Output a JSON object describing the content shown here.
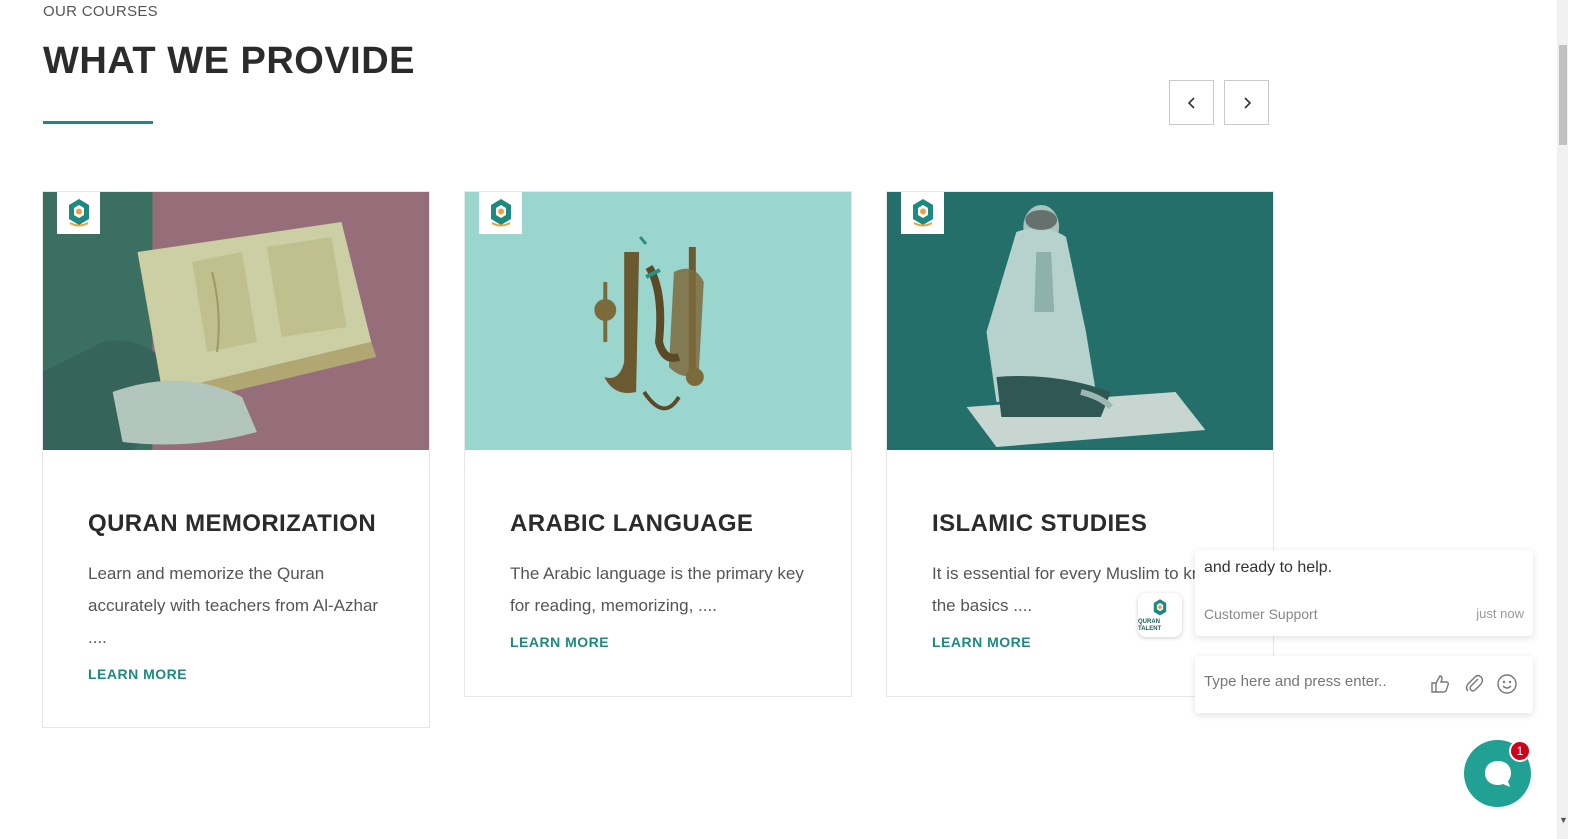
{
  "section": {
    "eyebrow": "OUR COURSES",
    "title": "WHAT WE PROVIDE"
  },
  "colors": {
    "accent": "#1c8a80",
    "chat_launcher": "#21a094",
    "badge": "#d0021b"
  },
  "carousel": {
    "prev_icon": "chevron-left-icon",
    "next_icon": "chevron-right-icon"
  },
  "cards": [
    {
      "title": "QURAN MEMORIZATION",
      "text": "Learn and memorize the Quran accurately with teachers from Al-Azhar ....",
      "link": "LEARN MORE",
      "image": "person-holding-quran"
    },
    {
      "title": "ARABIC LANGUAGE",
      "text": "The Arabic language is the primary key for reading, memorizing, ....",
      "link": "LEARN MORE",
      "image": "arabic-calligraphy-iqra"
    },
    {
      "title": "ISLAMIC STUDIES",
      "text": "It is essential for every Muslim to know the basics ....",
      "link": "LEARN MORE",
      "image": "man-praying-on-mat"
    }
  ],
  "chat": {
    "message": "and ready to help.",
    "sender": "Customer Support",
    "time": "just now",
    "avatar_text": "QURAN TALENT",
    "input_placeholder": "Type here and press enter..",
    "badge_count": "1"
  }
}
